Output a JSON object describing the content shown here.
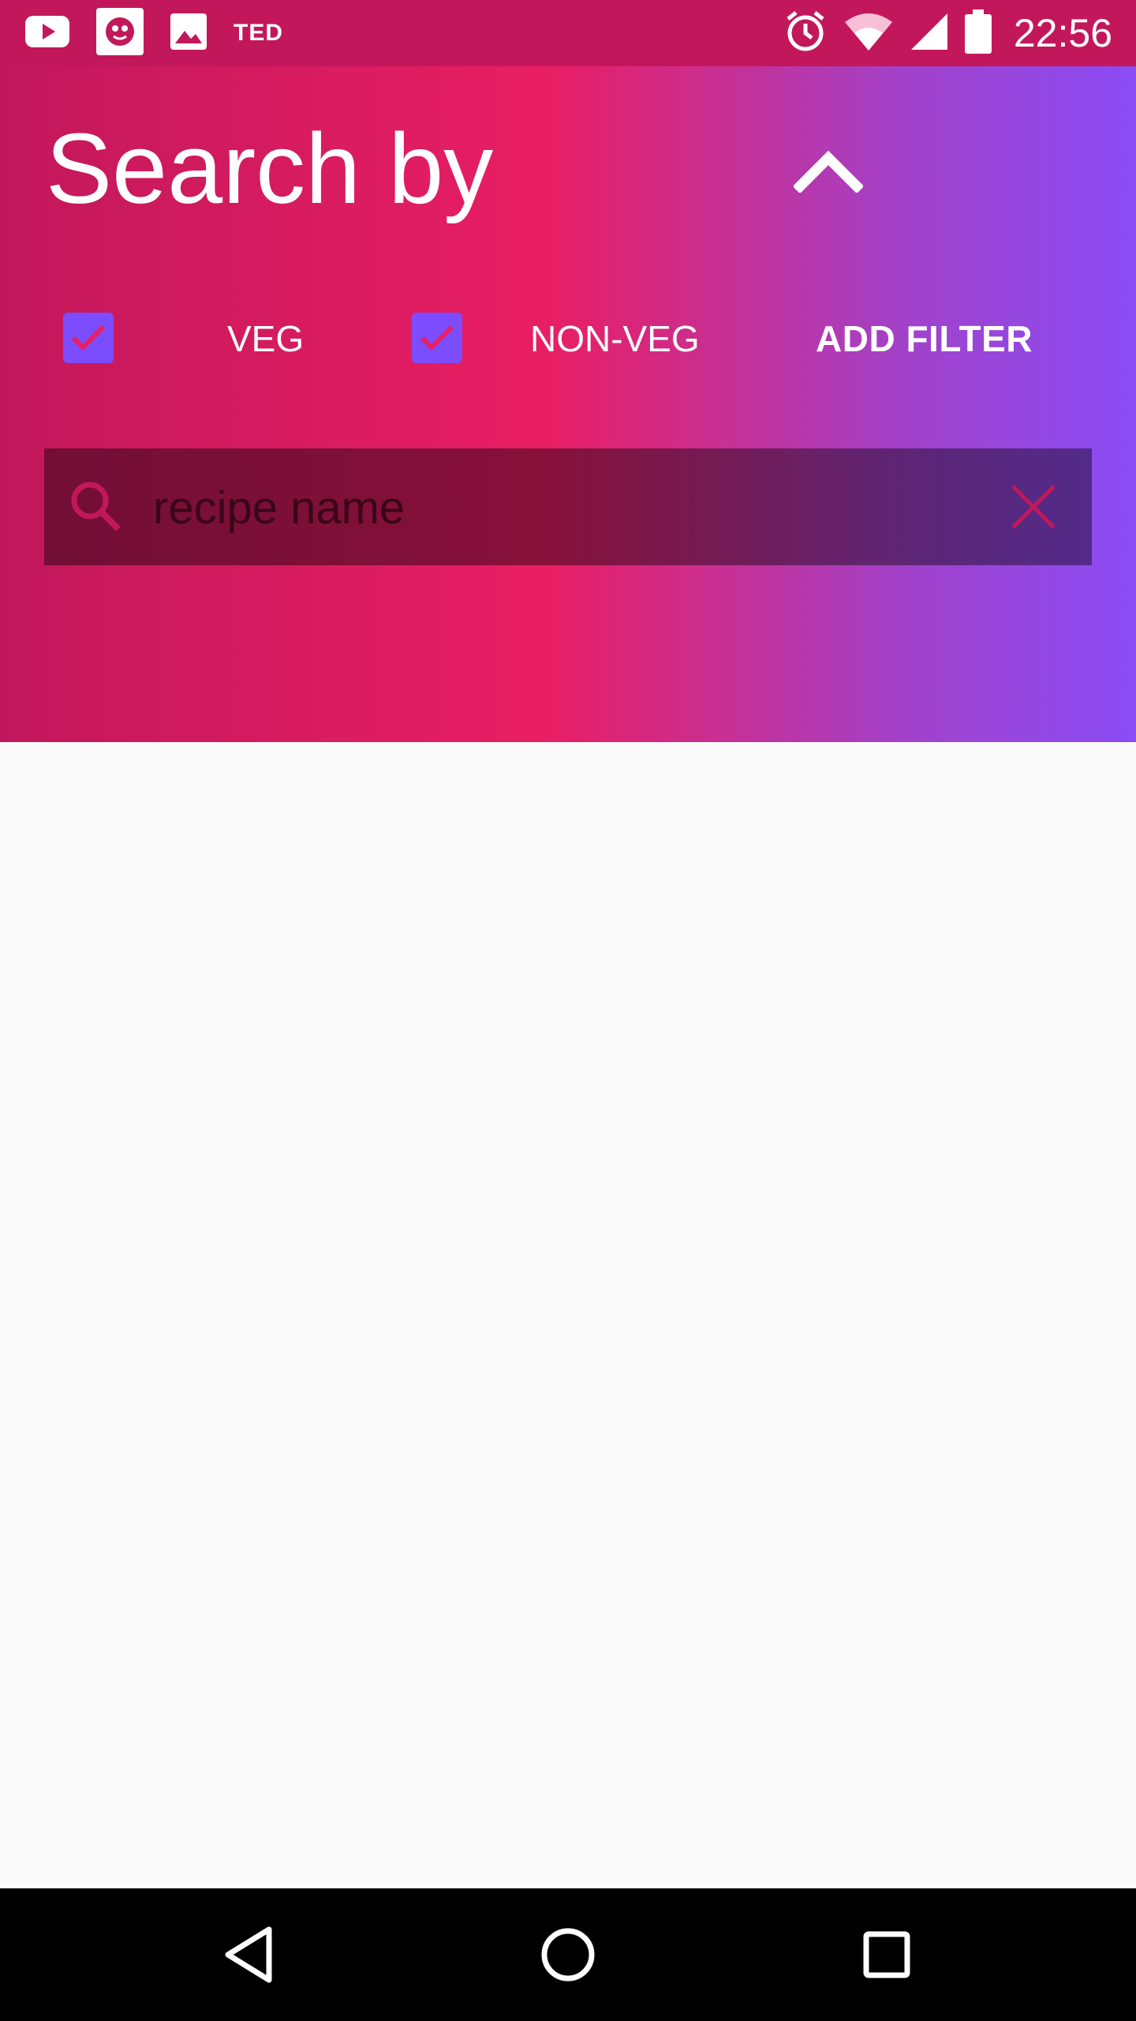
{
  "status_bar": {
    "notification_label": "TED",
    "time": "22:56",
    "icons": [
      "youtube-icon",
      "app-notification-icon",
      "image-icon",
      "alarm-icon",
      "wifi-icon",
      "signal-icon",
      "battery-icon"
    ]
  },
  "header": {
    "title": "Search by",
    "collapse_icon": "chevron-up-icon",
    "gradient_colors": [
      "#c2185b",
      "#e91e63",
      "#8a4cf5"
    ]
  },
  "filters": {
    "veg": {
      "label": "VEG",
      "checked": true
    },
    "non_veg": {
      "label": "NON-VEG",
      "checked": true
    },
    "add_filter_label": "ADD FILTER",
    "checkbox_color": "#7c4dff",
    "checkmark_color": "#e91e63"
  },
  "search": {
    "placeholder": "recipe name",
    "value": ""
  },
  "nav_bar": {
    "buttons": [
      "back-icon",
      "home-icon",
      "recents-icon"
    ]
  }
}
